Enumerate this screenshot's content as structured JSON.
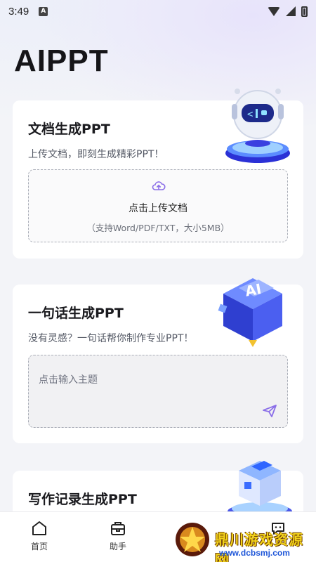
{
  "status_bar": {
    "time": "3:49",
    "notification_icon": "a-icon",
    "icons": [
      "wifi-icon",
      "signal-icon",
      "battery-icon"
    ]
  },
  "page": {
    "title": "AIPPT"
  },
  "cards": {
    "doc": {
      "title": "文档生成PPT",
      "subtitle": "上传文档，即刻生成精彩PPT！",
      "upload_label": "点击上传文档",
      "upload_hint": "（支持Word/PDF/TXT，大小5MB）",
      "illustration": "robot-illustration"
    },
    "sentence": {
      "title": "一句话生成PPT",
      "subtitle": "没有灵感？一句话帮你制作专业PPT！",
      "input_placeholder": "点击输入主题",
      "illustration": "ai-cube-illustration"
    },
    "notes": {
      "title": "写作记录生成PPT",
      "illustration": "blocks-illustration"
    }
  },
  "bottom_nav": {
    "items": [
      {
        "label": "首页",
        "icon": "home-icon"
      },
      {
        "label": "助手",
        "icon": "toolbox-icon"
      },
      {
        "label": "",
        "icon": "chat-bubble-icon"
      }
    ]
  },
  "watermark": {
    "title": "鼎川游戏资源网",
    "url": "www.dcbsmj.com"
  },
  "colors": {
    "accent": "#8b6fe8",
    "background": "#f3f4f8",
    "card": "#ffffff"
  }
}
